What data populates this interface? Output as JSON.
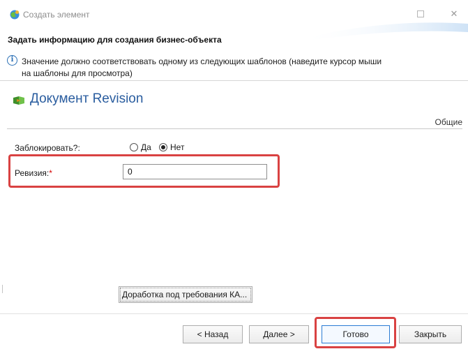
{
  "window": {
    "title": "Создать элемент",
    "maximize_icon": "maximize-icon",
    "close_glyph": "✕"
  },
  "header": {
    "title": "Задать информацию для создания бизнес-объекта",
    "info": "Значение должно соответствовать одному из следующих шаблонов (наведите курсор мыши на шаблоны для просмотра)"
  },
  "document": {
    "title": "Документ Revision",
    "icon": "document-type-icon"
  },
  "section": {
    "label": "Общие"
  },
  "form": {
    "lock_label": "Заблокировать?:",
    "lock_options": [
      "Да",
      "Нет"
    ],
    "lock_selected": "Нет",
    "revision_label": "Ревизия:",
    "required_mark": "*",
    "revision_value": "0"
  },
  "actions": {
    "rework_label": "Доработка под требования КА...",
    "back_label": "< Назад",
    "next_label": "Далее >",
    "done_label": "Готово",
    "close_label": "Закрыть"
  },
  "colors": {
    "highlight": "#d94242",
    "title_blue": "#2a5d9f",
    "default_button_border": "#2a7bd4"
  }
}
